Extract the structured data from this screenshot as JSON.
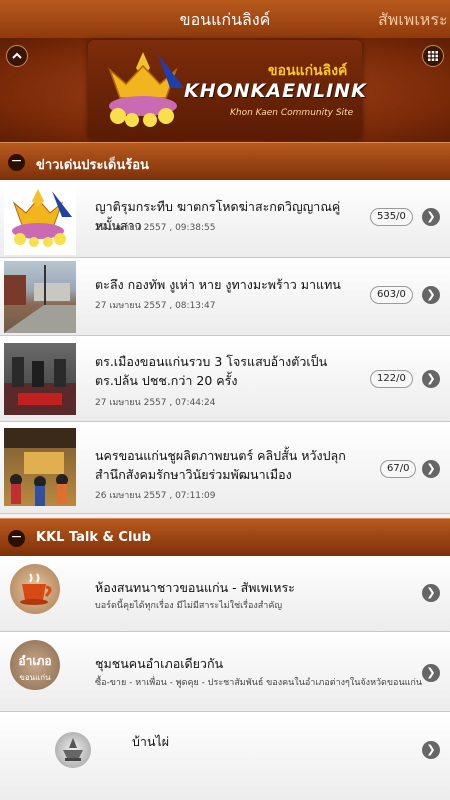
{
  "topbar": {
    "title": "ขอนแก่นลิงค์",
    "next_title": "สัพเพเหระ"
  },
  "banner": {
    "logo_thai": "ขอนแก่นลิงค์",
    "logo_main": "KHONKAENLINK",
    "logo_sub": "Khon Kaen Community Site",
    "left_icon": "chevron-up-icon",
    "right_icon": "grid-icon"
  },
  "news": {
    "heading": "ข่าวเด่นประเด็นร้อน",
    "items": [
      {
        "title": "ญาติรุมกระทืบ ฆาตกรโหดฆ่าสะกดวิญญาณคู่หมั้นสาว",
        "date": "27 เมษายน 2557 , 09:38:55",
        "count": "535/0"
      },
      {
        "title": "ตะลึง กองทัพ งูเห่า หาย งูทางมะพร้าว มาแทน",
        "date": "27 เมษายน 2557 , 08:13:47",
        "count": "603/0"
      },
      {
        "title": "ตร.เมืองขอนแก่นรวบ 3 โจรแสบอ้างตัวเป็น ตร.ปล้น ปชช.กว่า 20 ครั้ง",
        "date": "27 เมษายน 2557 , 07:44:24",
        "count": "122/0"
      },
      {
        "title": "นครขอนแก่นชูผลิตภาพยนตร์ คลิปสั้น หวังปลุกสำนึกสังคมรักษาวินัยร่วมพัฒนาเมือง",
        "date": "26 เมษายน 2557 , 07:11:09",
        "count": "67/0"
      }
    ]
  },
  "club": {
    "heading": "KKL Talk & Club",
    "items": [
      {
        "title": "ห้องสนทนาชาวขอนแก่น - สัพเพเหระ",
        "desc": "บอร์ดนี้คุยได้ทุกเรื่อง มีไม่มีสาระไม่ใช่เรื่องสำคัญ",
        "icon": "coffee-cup-icon"
      },
      {
        "title": "ชุมชนคนอำเภอเดียวกัน",
        "desc": "ซื้อ-ขาย - หาเพื่อน - พูดคุย - ประชาสัมพันธ์ ของคนในอำเภอต่างๆในจังหวัดขอนแก่น",
        "icon": "district-icon",
        "icon_text_1": "อำเภอ",
        "icon_text_2": "ขอนแก่น"
      },
      {
        "title": "บ้านไผ่",
        "desc": "",
        "icon": "temple-icon"
      }
    ]
  }
}
